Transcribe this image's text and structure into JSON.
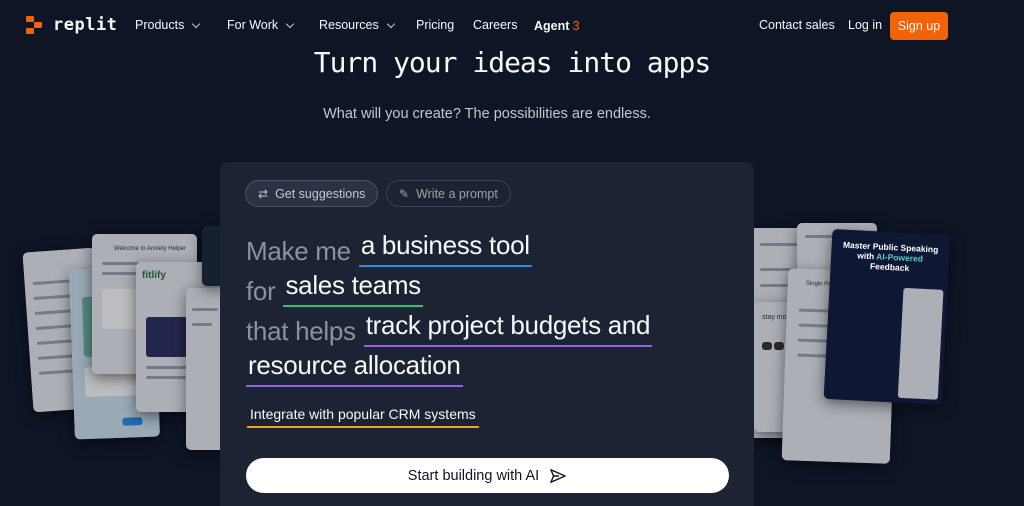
{
  "nav": {
    "logo": "replit",
    "items": [
      {
        "label": "Products",
        "has_dropdown": true
      },
      {
        "label": "For Work",
        "has_dropdown": true
      },
      {
        "label": "Resources",
        "has_dropdown": true
      },
      {
        "label": "Pricing",
        "has_dropdown": false
      },
      {
        "label": "Careers",
        "has_dropdown": false
      },
      {
        "label": "Agent",
        "has_dropdown": false
      }
    ],
    "agent_badge": "3",
    "contact_sales": "Contact sales",
    "login": "Log in",
    "signup": "Sign up"
  },
  "hero": {
    "title": "Turn your ideas into apps",
    "subtitle": "What will you create? The possibilities are endless."
  },
  "prompt_panel": {
    "tabs": [
      {
        "label": "Get suggestions",
        "icon": "shuffle-icon",
        "active": true
      },
      {
        "label": "Write a prompt",
        "icon": "edit-icon",
        "active": false
      }
    ],
    "lines": {
      "l1_prefix": "Make me",
      "l1_value": "a business tool",
      "l2_prefix": "for",
      "l2_value": "sales teams",
      "l3_prefix": "that helps",
      "l3_value": "track project budgets and",
      "l4_value": "resource allocation"
    },
    "integration": "Integrate with popular CRM systems",
    "start_button": "Start building with AI"
  },
  "preview_cards": {
    "anxiety": "Welcome to Anxiety Helper",
    "fitlify": "fitlify",
    "property": "Single Property Loan Calculator",
    "motivated": "stay motivated!",
    "speaking": {
      "line1": "Master Public Speaking",
      "line2": "with",
      "highlight": "AI-Powered",
      "line3": "Feedback"
    }
  },
  "colors": {
    "background": "#0e1525",
    "panel": "#1c2333",
    "brand_orange": "#f26207",
    "underline_blue": "#2b8be6",
    "underline_green": "#2ec271",
    "underline_purple": "#9b5de5",
    "underline_yellow": "#e8a330"
  }
}
